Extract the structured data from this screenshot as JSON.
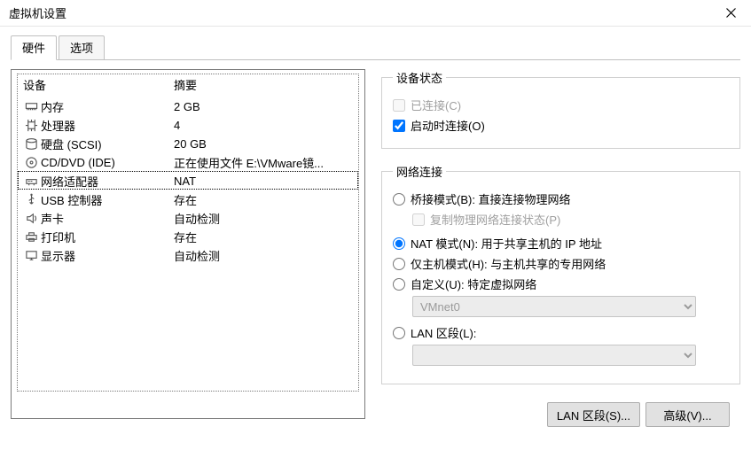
{
  "window": {
    "title": "虚拟机设置"
  },
  "tabs": {
    "hardware": "硬件",
    "options": "选项"
  },
  "device_list": {
    "header_device": "设备",
    "header_summary": "摘要",
    "items": [
      {
        "icon": "memory-icon",
        "name": "内存",
        "summary": "2 GB"
      },
      {
        "icon": "cpu-icon",
        "name": "处理器",
        "summary": "4"
      },
      {
        "icon": "disk-icon",
        "name": "硬盘 (SCSI)",
        "summary": "20 GB"
      },
      {
        "icon": "cd-icon",
        "name": "CD/DVD (IDE)",
        "summary": "正在使用文件 E:\\VMware镜..."
      },
      {
        "icon": "network-icon",
        "name": "网络适配器",
        "summary": "NAT"
      },
      {
        "icon": "usb-icon",
        "name": "USB 控制器",
        "summary": "存在"
      },
      {
        "icon": "sound-icon",
        "name": "声卡",
        "summary": "自动检测"
      },
      {
        "icon": "printer-icon",
        "name": "打印机",
        "summary": "存在"
      },
      {
        "icon": "display-icon",
        "name": "显示器",
        "summary": "自动检测"
      }
    ],
    "selected_index": 4
  },
  "status_group": {
    "legend": "设备状态",
    "connected": "已连接(C)",
    "connect_at_power_on": "启动时连接(O)"
  },
  "network_group": {
    "legend": "网络连接",
    "bridged": "桥接模式(B): 直接连接物理网络",
    "replicate": "复制物理网络连接状态(P)",
    "nat": "NAT 模式(N): 用于共享主机的 IP 地址",
    "hostonly": "仅主机模式(H): 与主机共享的专用网络",
    "custom": "自定义(U): 特定虚拟网络",
    "custom_select": "VMnet0",
    "lanseg": "LAN 区段(L):",
    "lanseg_select": ""
  },
  "buttons": {
    "lan_segments": "LAN 区段(S)...",
    "advanced": "高级(V)..."
  }
}
